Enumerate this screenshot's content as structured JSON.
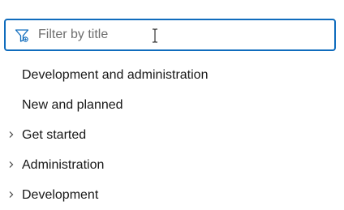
{
  "filter": {
    "placeholder": "Filter by title",
    "value": "",
    "icon": "filter-icon"
  },
  "toc": {
    "items": [
      {
        "label": "Development and administration",
        "expandable": false
      },
      {
        "label": "New and planned",
        "expandable": false
      },
      {
        "label": "Get started",
        "expandable": true
      },
      {
        "label": "Administration",
        "expandable": true
      },
      {
        "label": "Development",
        "expandable": true
      }
    ]
  },
  "colors": {
    "accent": "#0f6cbd",
    "text": "#171717",
    "placeholder": "#6e6e6e"
  }
}
